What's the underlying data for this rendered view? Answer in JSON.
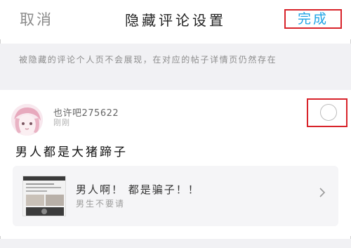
{
  "header": {
    "cancel_label": "取消",
    "title": "隐藏评论设置",
    "done_label": "完成"
  },
  "notice": {
    "text": "被隐藏的评论个人页不会展现，在对应的帖子详情页仍然存在"
  },
  "comment": {
    "username": "也许吧275622",
    "time": "刚刚",
    "content": "男人都是大猪蹄子",
    "selected": false,
    "post": {
      "title": "男人啊！ 都是骗子！！",
      "subtitle": "男生不要请"
    }
  },
  "colors": {
    "done": "#1fa3e6",
    "highlight_border": "#d8232a",
    "notice_bg": "#f1f1f4"
  },
  "icons": {
    "radio": "radio-unchecked-icon",
    "chevron": "chevron-right-icon"
  }
}
